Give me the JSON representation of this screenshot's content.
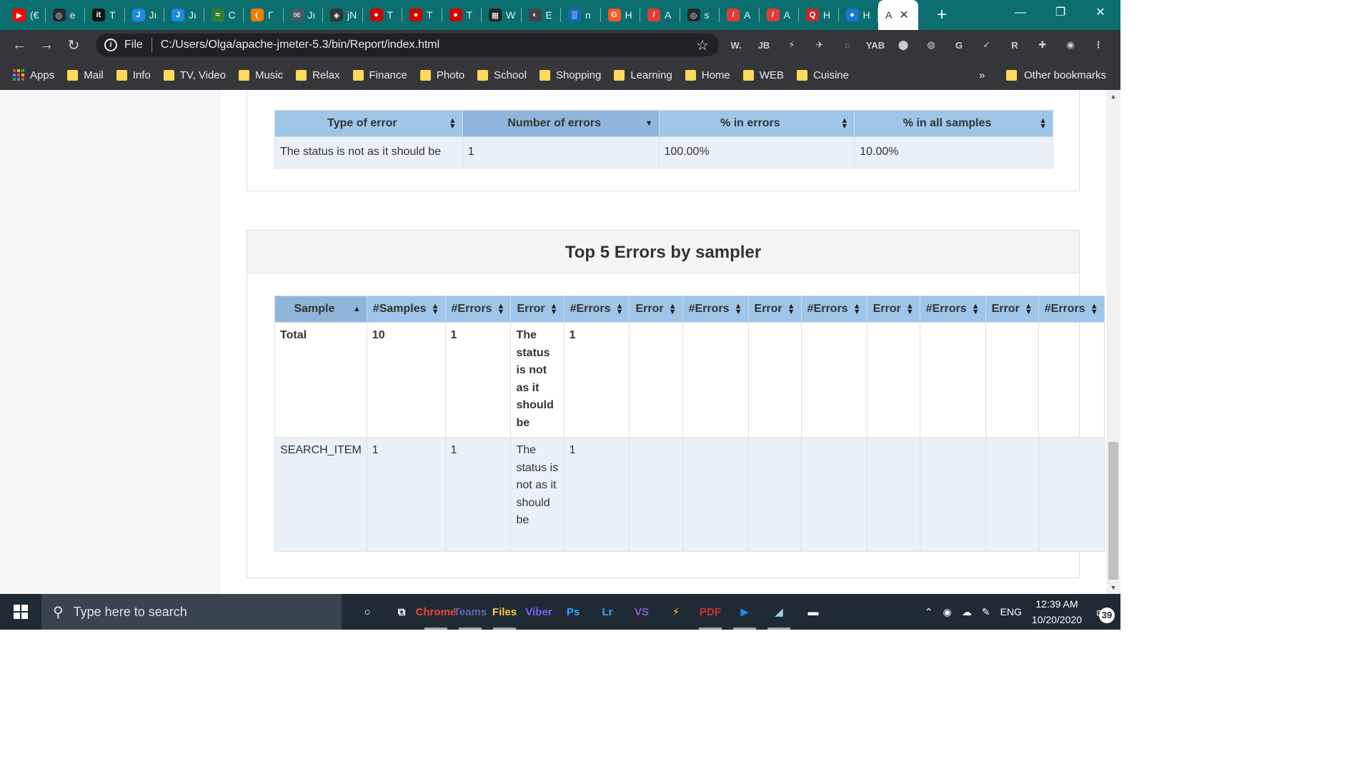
{
  "browser": {
    "tabs": [
      {
        "fav": "▶",
        "color": "#ff0000",
        "label": "(€"
      },
      {
        "fav": "◎",
        "color": "#24292e",
        "label": "e"
      },
      {
        "fav": "it",
        "color": "#111111",
        "label": "T"
      },
      {
        "fav": "J",
        "color": "#1e88e5",
        "label": "Jı"
      },
      {
        "fav": "J",
        "color": "#1e88e5",
        "label": "Jı"
      },
      {
        "fav": "≈",
        "color": "#2e7d32",
        "label": "C"
      },
      {
        "fav": "❨",
        "color": "#f57c00",
        "label": "Γ"
      },
      {
        "fav": "✉",
        "color": "#455a64",
        "label": "Jı"
      },
      {
        "fav": "◈",
        "color": "#333333",
        "label": "jN"
      },
      {
        "fav": "●",
        "color": "#d50000",
        "label": "T"
      },
      {
        "fav": "●",
        "color": "#d50000",
        "label": "T"
      },
      {
        "fav": "●",
        "color": "#d50000",
        "label": "T"
      },
      {
        "fav": "▦",
        "color": "#222222",
        "label": "W"
      },
      {
        "fav": "◐",
        "color": "#444444",
        "label": "E"
      },
      {
        "fav": "▒",
        "color": "#1565c0",
        "label": "n"
      },
      {
        "fav": "G",
        "color": "#ff5722",
        "label": "H"
      },
      {
        "fav": "/",
        "color": "#e53935",
        "label": "A"
      },
      {
        "fav": "◎",
        "color": "#24292e",
        "label": "s"
      },
      {
        "fav": "/",
        "color": "#e53935",
        "label": "A"
      },
      {
        "fav": "/",
        "color": "#e53935",
        "label": "A"
      },
      {
        "fav": "Q",
        "color": "#c62828",
        "label": "H"
      },
      {
        "fav": "●",
        "color": "#1976d2",
        "label": "H"
      }
    ],
    "active_tab": {
      "label": "A",
      "close": "✕"
    },
    "new_tab": "+",
    "window_controls": {
      "minimize": "—",
      "restore": "❐",
      "close": "✕"
    },
    "nav": {
      "back": "←",
      "forward": "→",
      "reload": "↻"
    },
    "address": {
      "scheme_label": "File",
      "url": "C:/Users/Olga/apache-jmeter-5.3/bin/Report/index.html",
      "info_icon": "i",
      "star": "☆"
    },
    "extensions": [
      "W.",
      "JB",
      "⚡",
      "✈",
      "◌",
      "YAB",
      "⬤",
      "◍",
      "G",
      "✓",
      "R",
      "✚",
      "◉",
      "⋮"
    ],
    "bookmarks": {
      "apps_label": "Apps",
      "items": [
        "Mail",
        "Info",
        "TV, Video",
        "Music",
        "Relax",
        "Finance",
        "Photo",
        "School",
        "Shopping",
        "Learning",
        "Home",
        "WEB",
        "Cuisine"
      ],
      "more": "»",
      "other": "Other bookmarks"
    }
  },
  "errors_table": {
    "columns": [
      "Type of error",
      "Number of errors",
      "% in errors",
      "% in all samples"
    ],
    "rows": [
      [
        "The status is not as it should be",
        "1",
        "100.00%",
        "10.00%"
      ]
    ]
  },
  "top5": {
    "title": "Top 5 Errors by sampler",
    "columns": [
      "Sample",
      "#Samples",
      "#Errors",
      "Error",
      "#Errors",
      "Error",
      "#Errors",
      "Error",
      "#Errors",
      "Error",
      "#Errors",
      "Error",
      "#Errors"
    ],
    "rows": [
      [
        "Total",
        "10",
        "1",
        "The status is not as it should be",
        "1",
        "",
        "",
        "",
        "",
        "",
        "",
        "",
        ""
      ],
      [
        "SEARCH_ITEM",
        "1",
        "1",
        "The status is not as it should be",
        "1",
        "",
        "",
        "",
        "",
        "",
        "",
        "",
        ""
      ]
    ]
  },
  "taskbar": {
    "search_placeholder": "Type here to search",
    "apps": [
      "○",
      "⧉",
      "Chrome",
      "Teams",
      "Files",
      "Viber",
      "Ps",
      "Lr",
      "VS",
      "⚡",
      "PDF",
      "▶",
      "◢",
      "▬"
    ],
    "tray": {
      "lang": "ENG",
      "time": "12:39 AM",
      "date": "10/20/2020",
      "notifications": "39"
    }
  }
}
